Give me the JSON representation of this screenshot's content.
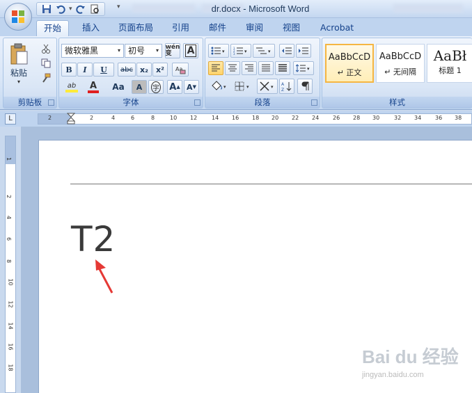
{
  "window": {
    "title": "dr.docx - Microsoft Word"
  },
  "tabs": [
    "开始",
    "插入",
    "页面布局",
    "引用",
    "邮件",
    "审阅",
    "视图",
    "Acrobat"
  ],
  "clipboard": {
    "paste_label": "粘贴",
    "group_label": "剪贴板"
  },
  "font": {
    "name_value": "微软雅黑",
    "size_value": "初号",
    "group_label": "字体",
    "phonetic_label": "wén 变",
    "border_label": "A",
    "bold": "B",
    "italic": "I",
    "underline": "U",
    "strike": "abc",
    "subscript": "x₂",
    "superscript": "x²",
    "highlight": "ab",
    "font_color": "A",
    "change_case": "Aa",
    "char_shading": "A",
    "enclose": "字",
    "grow": "A",
    "shrink": "A"
  },
  "paragraph": {
    "group_label": "段落"
  },
  "styles": {
    "group_label": "样式",
    "items": [
      {
        "sample": "AaBbCcD",
        "name": "↵ 正文"
      },
      {
        "sample": "AaBbCcD",
        "name": "↵ 无间隔"
      },
      {
        "sample": "AaBł",
        "name": "标题 1"
      }
    ]
  },
  "ruler": {
    "h_numbers": [
      "2",
      "2",
      "4",
      "6",
      "8",
      "10",
      "12",
      "14",
      "16",
      "18",
      "20",
      "22",
      "24",
      "26",
      "28",
      "30",
      "32",
      "34",
      "36",
      "38"
    ],
    "v_numbers": [
      "1",
      "2",
      "4",
      "6",
      "8",
      "10",
      "12",
      "14",
      "16",
      "18"
    ],
    "tab_selector": "L"
  },
  "document": {
    "text": "T2"
  },
  "watermark": {
    "brand": "Bai du 经验",
    "site": "jingyan.baidu.com"
  },
  "colors": {
    "accent": "#15428b",
    "arrow": "#e53935",
    "selected_style": "#f5b642"
  }
}
